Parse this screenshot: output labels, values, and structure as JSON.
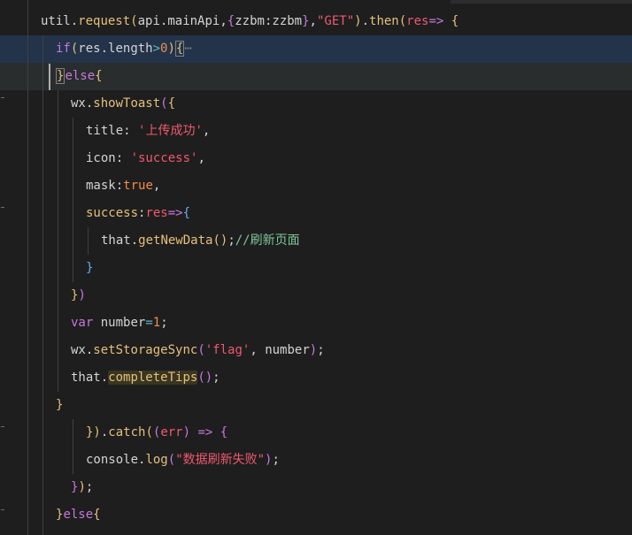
{
  "editor": {
    "lines": [
      {
        "indent": 46,
        "hl": "",
        "tokens": [
          {
            "t": "util",
            "c": "t"
          },
          {
            "t": ".",
            "c": "t"
          },
          {
            "t": "request",
            "c": "y"
          },
          {
            "t": "(",
            "c": "y"
          },
          {
            "t": "api",
            "c": "t"
          },
          {
            "t": ".",
            "c": "t"
          },
          {
            "t": "mainApi",
            "c": "t"
          },
          {
            "t": ",",
            "c": "t"
          },
          {
            "t": "{",
            "c": "p"
          },
          {
            "t": "zzbm",
            "c": "t"
          },
          {
            "t": ":",
            "c": "t"
          },
          {
            "t": "zzbm",
            "c": "t"
          },
          {
            "t": "}",
            "c": "p"
          },
          {
            "t": ",",
            "c": "t"
          },
          {
            "t": "\"GET\"",
            "c": "r"
          },
          {
            "t": ")",
            "c": "y"
          },
          {
            "t": ".",
            "c": "t"
          },
          {
            "t": "then",
            "c": "y"
          },
          {
            "t": "(",
            "c": "y"
          },
          {
            "t": "res",
            "c": "r"
          },
          {
            "t": "=>",
            "c": "p"
          },
          {
            "t": " ",
            "c": "t"
          },
          {
            "t": "{",
            "c": "y"
          }
        ]
      },
      {
        "indent": 63,
        "hl": "blue",
        "tokens": [
          {
            "t": "if",
            "c": "p"
          },
          {
            "t": "(",
            "c": "y"
          },
          {
            "t": "res",
            "c": "t"
          },
          {
            "t": ".",
            "c": "t"
          },
          {
            "t": "length",
            "c": "t"
          },
          {
            "t": ">",
            "c": "c"
          },
          {
            "t": "0",
            "c": "o"
          },
          {
            "t": ")",
            "c": "y"
          },
          {
            "t": "{",
            "c": "y",
            "box": true
          },
          {
            "t": "⋯",
            "c": "ellipsis"
          }
        ]
      },
      {
        "indent": 63,
        "hl": "gray",
        "tokens": [
          {
            "t": "}",
            "c": "y",
            "box": true
          },
          {
            "t": "else",
            "c": "p"
          },
          {
            "t": "{",
            "c": "y"
          }
        ]
      },
      {
        "indent": 80,
        "hl": "",
        "tokens": [
          {
            "t": "wx",
            "c": "t"
          },
          {
            "t": ".",
            "c": "t"
          },
          {
            "t": "showToast",
            "c": "y"
          },
          {
            "t": "(",
            "c": "p"
          },
          {
            "t": "{",
            "c": "y"
          }
        ]
      },
      {
        "indent": 97,
        "hl": "",
        "tokens": [
          {
            "t": "title",
            "c": "t"
          },
          {
            "t": ": ",
            "c": "t"
          },
          {
            "t": "'上传成功'",
            "c": "r"
          },
          {
            "t": ",",
            "c": "t"
          }
        ]
      },
      {
        "indent": 97,
        "hl": "",
        "tokens": [
          {
            "t": "icon",
            "c": "t"
          },
          {
            "t": ": ",
            "c": "t"
          },
          {
            "t": "'success'",
            "c": "r"
          },
          {
            "t": ",",
            "c": "t"
          }
        ]
      },
      {
        "indent": 97,
        "hl": "",
        "tokens": [
          {
            "t": "mask",
            "c": "t"
          },
          {
            "t": ":",
            "c": "t"
          },
          {
            "t": "true",
            "c": "o"
          },
          {
            "t": ",",
            "c": "t"
          }
        ]
      },
      {
        "indent": 97,
        "hl": "",
        "tokens": [
          {
            "t": "success",
            "c": "y"
          },
          {
            "t": ":",
            "c": "t"
          },
          {
            "t": "res",
            "c": "r"
          },
          {
            "t": "=>",
            "c": "p"
          },
          {
            "t": "{",
            "c": "b"
          }
        ]
      },
      {
        "indent": 114,
        "hl": "",
        "tokens": [
          {
            "t": "that",
            "c": "t"
          },
          {
            "t": ".",
            "c": "t"
          },
          {
            "t": "getNewData",
            "c": "y"
          },
          {
            "t": "()",
            "c": "y"
          },
          {
            "t": ";",
            "c": "t"
          },
          {
            "t": "//刷新页面",
            "c": "g"
          }
        ]
      },
      {
        "indent": 97,
        "hl": "",
        "tokens": [
          {
            "t": "}",
            "c": "b"
          }
        ]
      },
      {
        "indent": 80,
        "hl": "",
        "tokens": [
          {
            "t": "}",
            "c": "y"
          },
          {
            "t": ")",
            "c": "p"
          }
        ]
      },
      {
        "indent": 80,
        "hl": "",
        "tokens": [
          {
            "t": "var",
            "c": "p"
          },
          {
            "t": " ",
            "c": "t"
          },
          {
            "t": "number",
            "c": "t"
          },
          {
            "t": "=",
            "c": "c"
          },
          {
            "t": "1",
            "c": "o"
          },
          {
            "t": ";",
            "c": "t"
          }
        ]
      },
      {
        "indent": 80,
        "hl": "",
        "tokens": [
          {
            "t": "wx",
            "c": "t"
          },
          {
            "t": ".",
            "c": "t"
          },
          {
            "t": "setStorageSync",
            "c": "y"
          },
          {
            "t": "(",
            "c": "p"
          },
          {
            "t": "'flag'",
            "c": "r"
          },
          {
            "t": ", ",
            "c": "t"
          },
          {
            "t": "number",
            "c": "t"
          },
          {
            "t": ")",
            "c": "p"
          },
          {
            "t": ";",
            "c": "t"
          }
        ]
      },
      {
        "indent": 80,
        "hl": "",
        "tokens": [
          {
            "t": "that",
            "c": "t"
          },
          {
            "t": ".",
            "c": "t"
          },
          {
            "t": "completeTips",
            "c": "y",
            "word": true
          },
          {
            "t": "()",
            "c": "p"
          },
          {
            "t": ";",
            "c": "t"
          }
        ]
      },
      {
        "indent": 63,
        "hl": "",
        "tokens": [
          {
            "t": "}",
            "c": "y"
          }
        ]
      },
      {
        "indent": 97,
        "hl": "",
        "tokens": [
          {
            "t": "})",
            "c": "y"
          },
          {
            "t": ".",
            "c": "t"
          },
          {
            "t": "catch",
            "c": "y"
          },
          {
            "t": "(",
            "c": "y"
          },
          {
            "t": "(",
            "c": "p"
          },
          {
            "t": "err",
            "c": "r"
          },
          {
            "t": ")",
            "c": "p"
          },
          {
            "t": " ",
            "c": "t"
          },
          {
            "t": "=>",
            "c": "p"
          },
          {
            "t": " ",
            "c": "t"
          },
          {
            "t": "{",
            "c": "p"
          }
        ]
      },
      {
        "indent": 97,
        "hl": "",
        "tokens": [
          {
            "t": "console",
            "c": "t"
          },
          {
            "t": ".",
            "c": "t"
          },
          {
            "t": "log",
            "c": "y"
          },
          {
            "t": "(",
            "c": "p"
          },
          {
            "t": "\"数据刷新失败\"",
            "c": "r"
          },
          {
            "t": ")",
            "c": "p"
          },
          {
            "t": ";",
            "c": "t"
          }
        ]
      },
      {
        "indent": 80,
        "hl": "",
        "tokens": [
          {
            "t": "}",
            "c": "p"
          },
          {
            "t": ")",
            "c": "y"
          },
          {
            "t": ";",
            "c": "t"
          }
        ]
      },
      {
        "indent": 63,
        "hl": "",
        "tokens": [
          {
            "t": "}",
            "c": "y"
          },
          {
            "t": "else",
            "c": "p"
          },
          {
            "t": "{",
            "c": "y"
          }
        ]
      }
    ]
  }
}
